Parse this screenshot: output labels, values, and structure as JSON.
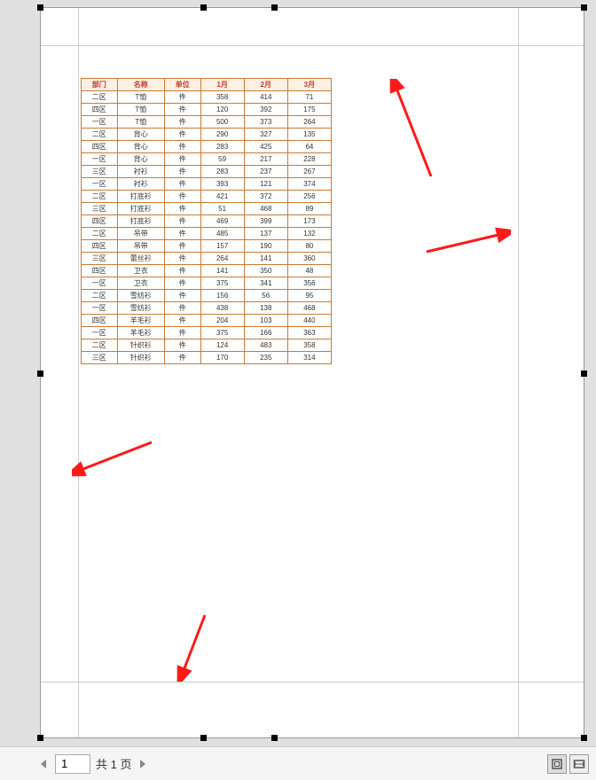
{
  "toolbar": {
    "current_page": "1",
    "page_total_label": "共 1 页"
  },
  "table": {
    "headers": [
      "部门",
      "名称",
      "单位",
      "1月",
      "2月",
      "3月"
    ],
    "rows": [
      [
        "二区",
        "T恤",
        "件",
        "358",
        "414",
        "71"
      ],
      [
        "四区",
        "T恤",
        "件",
        "120",
        "392",
        "175"
      ],
      [
        "一区",
        "T恤",
        "件",
        "500",
        "373",
        "264"
      ],
      [
        "二区",
        "背心",
        "件",
        "290",
        "327",
        "135"
      ],
      [
        "四区",
        "背心",
        "件",
        "283",
        "425",
        "64"
      ],
      [
        "一区",
        "背心",
        "件",
        "59",
        "217",
        "228"
      ],
      [
        "三区",
        "衬衫",
        "件",
        "283",
        "237",
        "267"
      ],
      [
        "一区",
        "衬衫",
        "件",
        "393",
        "121",
        "374"
      ],
      [
        "二区",
        "打底衫",
        "件",
        "421",
        "372",
        "256"
      ],
      [
        "三区",
        "打底衫",
        "件",
        "51",
        "468",
        "89"
      ],
      [
        "四区",
        "打底衫",
        "件",
        "469",
        "399",
        "173"
      ],
      [
        "二区",
        "吊带",
        "件",
        "485",
        "137",
        "132"
      ],
      [
        "四区",
        "吊带",
        "件",
        "157",
        "190",
        "80"
      ],
      [
        "三区",
        "蕾丝衫",
        "件",
        "264",
        "141",
        "360"
      ],
      [
        "四区",
        "卫衣",
        "件",
        "141",
        "350",
        "48"
      ],
      [
        "一区",
        "卫衣",
        "件",
        "375",
        "341",
        "356"
      ],
      [
        "二区",
        "雪纺衫",
        "件",
        "156",
        "56",
        "95"
      ],
      [
        "一区",
        "雪纺衫",
        "件",
        "438",
        "138",
        "468"
      ],
      [
        "四区",
        "羊毛衫",
        "件",
        "204",
        "103",
        "440"
      ],
      [
        "一区",
        "羊毛衫",
        "件",
        "375",
        "166",
        "363"
      ],
      [
        "二区",
        "针织衫",
        "件",
        "124",
        "483",
        "358"
      ],
      [
        "三区",
        "针织衫",
        "件",
        "170",
        "235",
        "314"
      ]
    ]
  }
}
